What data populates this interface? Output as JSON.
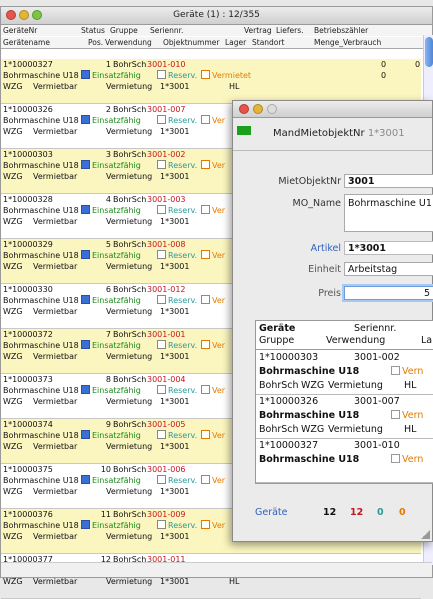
{
  "main_window": {
    "title": "Geräte (1) : 12/355",
    "headers_row1": [
      "GeräteNr",
      "Status",
      "Gruppe",
      "Seriennr.",
      "Vertrag",
      "Liefers.",
      "Betriebszähler"
    ],
    "headers_row2": [
      "Gerätename",
      "Pos.",
      "Verwendung",
      "Objektnummer",
      "Lager",
      "Standort",
      "Menge_Verbrauch"
    ],
    "records": [
      {
        "nr": "1*10000327",
        "pos": "1",
        "grp": "BohrSch",
        "ser": "3001-010",
        "name": "Bohrmaschine U18",
        "status": "Einsatzfähig",
        "reserv": "Reserv.",
        "vermietet": "Vermietet",
        "lager": "WZG",
        "verw_label": "Vermietbar",
        "verw": "Vermietung",
        "obj": "1*3001",
        "hl": "HL",
        "z1": "0",
        "z2": "0",
        "z3": "0"
      },
      {
        "nr": "1*10000326",
        "pos": "2",
        "grp": "BohrSch",
        "ser": "3001-007",
        "name": "Bohrmaschine U18",
        "status": "Einsatzfähig",
        "reserv": "Reserv.",
        "vermietet": "Ver",
        "lager": "WZG",
        "verw_label": "Vermietbar",
        "verw": "Vermietung",
        "obj": "1*3001",
        "hl": "",
        "z1": "",
        "z2": "",
        "z3": ""
      },
      {
        "nr": "1*10000303",
        "pos": "3",
        "grp": "BohrSch",
        "ser": "3001-002",
        "name": "Bohrmaschine U18",
        "status": "Einsatzfähig",
        "reserv": "Reserv.",
        "vermietet": "Ver",
        "lager": "WZG",
        "verw_label": "Vermietbar",
        "verw": "Vermietung",
        "obj": "1*3001",
        "hl": "",
        "z1": "",
        "z2": "",
        "z3": ""
      },
      {
        "nr": "1*10000328",
        "pos": "4",
        "grp": "BohrSch",
        "ser": "3001-003",
        "name": "Bohrmaschine U18",
        "status": "Einsatzfähig",
        "reserv": "Reserv.",
        "vermietet": "Ver",
        "lager": "WZG",
        "verw_label": "Vermietbar",
        "verw": "Vermietung",
        "obj": "1*3001",
        "hl": "",
        "z1": "",
        "z2": "",
        "z3": ""
      },
      {
        "nr": "1*10000329",
        "pos": "5",
        "grp": "BohrSch",
        "ser": "3001-008",
        "name": "Bohrmaschine U18",
        "status": "Einsatzfähig",
        "reserv": "Reserv.",
        "vermietet": "Ver",
        "lager": "WZG",
        "verw_label": "Vermietbar",
        "verw": "Vermietung",
        "obj": "1*3001",
        "hl": "",
        "z1": "",
        "z2": "",
        "z3": ""
      },
      {
        "nr": "1*10000330",
        "pos": "6",
        "grp": "BohrSch",
        "ser": "3001-012",
        "name": "Bohrmaschine U18",
        "status": "Einsatzfähig",
        "reserv": "Reserv.",
        "vermietet": "Ver",
        "lager": "WZG",
        "verw_label": "Vermietbar",
        "verw": "Vermietung",
        "obj": "1*3001",
        "hl": "",
        "z1": "",
        "z2": "",
        "z3": ""
      },
      {
        "nr": "1*10000372",
        "pos": "7",
        "grp": "BohrSch",
        "ser": "3001-001",
        "name": "Bohrmaschine U18",
        "status": "Einsatzfähig",
        "reserv": "Reserv.",
        "vermietet": "Ver",
        "lager": "WZG",
        "verw_label": "Vermietbar",
        "verw": "Vermietung",
        "obj": "1*3001",
        "hl": "",
        "z1": "",
        "z2": "",
        "z3": ""
      },
      {
        "nr": "1*10000373",
        "pos": "8",
        "grp": "BohrSch",
        "ser": "3001-004",
        "name": "Bohrmaschine U18",
        "status": "Einsatzfähig",
        "reserv": "Reserv.",
        "vermietet": "Ver",
        "lager": "WZG",
        "verw_label": "Vermietbar",
        "verw": "Vermietung",
        "obj": "1*3001",
        "hl": "",
        "z1": "",
        "z2": "",
        "z3": ""
      },
      {
        "nr": "1*10000374",
        "pos": "9",
        "grp": "BohrSch",
        "ser": "3001-005",
        "name": "Bohrmaschine U18",
        "status": "Einsatzfähig",
        "reserv": "Reserv.",
        "vermietet": "Ver",
        "lager": "WZG",
        "verw_label": "Vermietbar",
        "verw": "Vermietung",
        "obj": "1*3001",
        "hl": "",
        "z1": "",
        "z2": "",
        "z3": ""
      },
      {
        "nr": "1*10000375",
        "pos": "10",
        "grp": "BohrSch",
        "ser": "3001-006",
        "name": "Bohrmaschine U18",
        "status": "Einsatzfähig",
        "reserv": "Reserv.",
        "vermietet": "Ver",
        "lager": "WZG",
        "verw_label": "Vermietbar",
        "verw": "Vermietung",
        "obj": "1*3001",
        "hl": "",
        "z1": "",
        "z2": "",
        "z3": ""
      },
      {
        "nr": "1*10000376",
        "pos": "11",
        "grp": "BohrSch",
        "ser": "3001-009",
        "name": "Bohrmaschine U18",
        "status": "Einsatzfähig",
        "reserv": "Reserv.",
        "vermietet": "Ver",
        "lager": "WZG",
        "verw_label": "Vermietbar",
        "verw": "Vermietung",
        "obj": "1*3001",
        "hl": "",
        "z1": "",
        "z2": "",
        "z3": ""
      },
      {
        "nr": "1*10000377",
        "pos": "12",
        "grp": "BohrSch",
        "ser": "3001-011",
        "name": "Bohrmaschine U18",
        "status": "Einsatzfähig",
        "reserv": "Reserv.",
        "vermietet": "Ver",
        "lager": "WZG",
        "verw_label": "Vermietbar",
        "verw": "Vermietung",
        "obj": "1*3001",
        "hl": "HL",
        "z1": "",
        "z2": "",
        "z3": ""
      }
    ]
  },
  "detail_window": {
    "header_field": "MandMietobjektNr",
    "header_value": "1*3001",
    "mietobjektnr_label": "MietObjektNr",
    "mietobjektnr_value": "3001",
    "mo_name_label": "MO_Name",
    "mo_name_value": "Bohrmaschine U1",
    "artikel_label": "Artikel",
    "artikel_value": "1*3001",
    "einheit_label": "Einheit",
    "einheit_value": "Arbeitstag",
    "preis_label": "Preis",
    "preis_value": "5",
    "sub_headers": [
      "Geräte",
      "Seriennr.",
      "Gruppe",
      "Verwendung",
      "La"
    ],
    "sub_rows": [
      {
        "nr": "1*10000303",
        "ser": "3001-002",
        "name": "Bohrmaschine U18",
        "verm": "Vern",
        "grp": "BohrSch",
        "lager": "WZG",
        "verw": "Vermietung",
        "hl": "HL"
      },
      {
        "nr": "1*10000326",
        "ser": "3001-007",
        "name": "Bohrmaschine U18",
        "verm": "Vern",
        "grp": "BohrSch",
        "lager": "WZG",
        "verw": "Vermietung",
        "hl": "HL"
      },
      {
        "nr": "1*10000327",
        "ser": "3001-010",
        "name": "Bohrmaschine U18",
        "verm": "Vern",
        "grp": "",
        "lager": "",
        "verw": "",
        "hl": ""
      }
    ],
    "summary_label": "Geräte",
    "summary_values": [
      "12",
      "12",
      "0",
      "0"
    ]
  },
  "colors": {
    "highlight_row": "#fbf6c0",
    "red": "#c4161c",
    "green": "#1a8a1a",
    "teal": "#2a9a9a",
    "orange": "#e07b00",
    "blue_link": "#3060c0"
  }
}
